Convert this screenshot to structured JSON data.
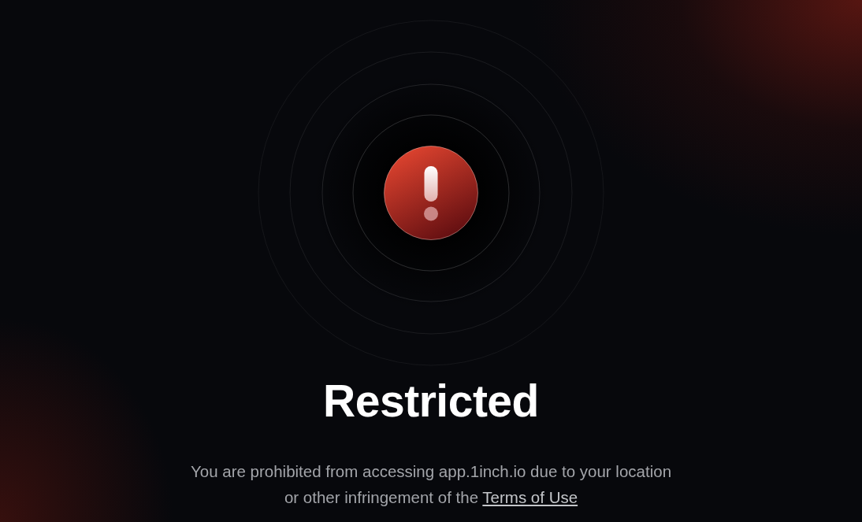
{
  "heading": "Restricted",
  "message": {
    "text": "You are prohibited from accessing app.1inch.io due to your location or other infringement of the",
    "link": "Terms of Use"
  }
}
